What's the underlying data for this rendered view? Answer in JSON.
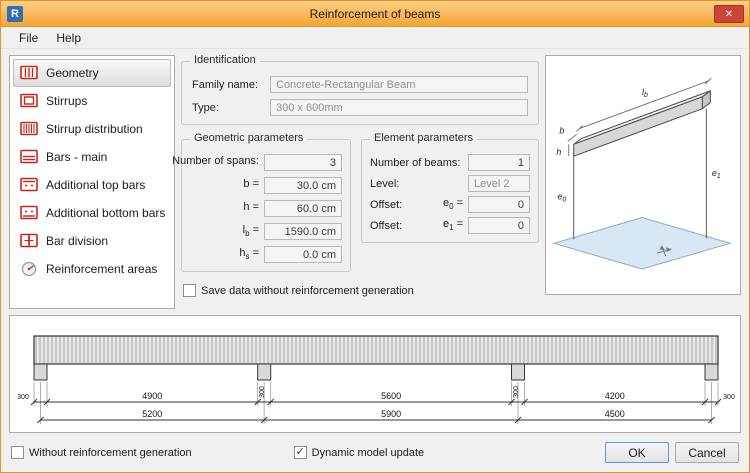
{
  "window": {
    "title": "Reinforcement of beams",
    "app_badge": "R",
    "close_glyph": "✕"
  },
  "menu": {
    "file": "File",
    "help": "Help"
  },
  "sidebar": {
    "items": [
      {
        "label": "Geometry",
        "selected": true
      },
      {
        "label": "Stirrups",
        "selected": false
      },
      {
        "label": "Stirrup distribution",
        "selected": false
      },
      {
        "label": "Bars - main",
        "selected": false
      },
      {
        "label": "Additional top bars",
        "selected": false
      },
      {
        "label": "Additional bottom bars",
        "selected": false
      },
      {
        "label": "Bar division",
        "selected": false
      },
      {
        "label": "Reinforcement areas",
        "selected": false
      }
    ]
  },
  "identification": {
    "title": "Identification",
    "family_label": "Family name:",
    "family_value": "Concrete-Rectangular Beam",
    "type_label": "Type:",
    "type_value": "300 x 600mm"
  },
  "geometric": {
    "title": "Geometric parameters",
    "rows": [
      {
        "main": "Number of spans:",
        "sub": "",
        "eq": "",
        "value": "3"
      },
      {
        "main": "b",
        "sub": "",
        "eq": " =",
        "value": "30.0 cm"
      },
      {
        "main": "h",
        "sub": "",
        "eq": " =",
        "value": "60.0 cm"
      },
      {
        "main": "l",
        "sub": "b",
        "eq": " =",
        "value": "1590.0 cm"
      },
      {
        "main": "h",
        "sub": "s",
        "eq": " =",
        "value": "0.0 cm"
      }
    ]
  },
  "element": {
    "title": "Element parameters",
    "rows": [
      {
        "label": "Number of beams:",
        "sym": "",
        "sub": "",
        "eq": "",
        "value": "1"
      },
      {
        "label": "Level:",
        "sym": "",
        "sub": "",
        "eq": "",
        "value": "Level 2"
      },
      {
        "label": "Offset:",
        "sym": "e",
        "sub": "0",
        "eq": " =",
        "value": "0"
      },
      {
        "label": "Offset:",
        "sym": "e",
        "sub": "1",
        "eq": " =",
        "value": "0"
      }
    ]
  },
  "save_checkbox": {
    "label": "Save data without reinforcement generation",
    "check_glyph": ""
  },
  "diagram": {
    "length_sym": "l",
    "length_sub": "b",
    "width_sym": "b",
    "height_sym": "h",
    "e0_sym": "e",
    "e0_sub": "0",
    "e1_sym": "e",
    "e1_sub": "1"
  },
  "drawing": {
    "support_width_label": "300",
    "span_dims": [
      "4900",
      "5600",
      "4200"
    ],
    "axis_dims": [
      "5200",
      "5900",
      "4500"
    ]
  },
  "footer": {
    "without_label": "Without reinforcement generation",
    "without_check_glyph": "",
    "dynamic_label": "Dynamic model update",
    "dynamic_check_glyph": "✓",
    "ok_label": "OK",
    "cancel_label": "Cancel"
  }
}
